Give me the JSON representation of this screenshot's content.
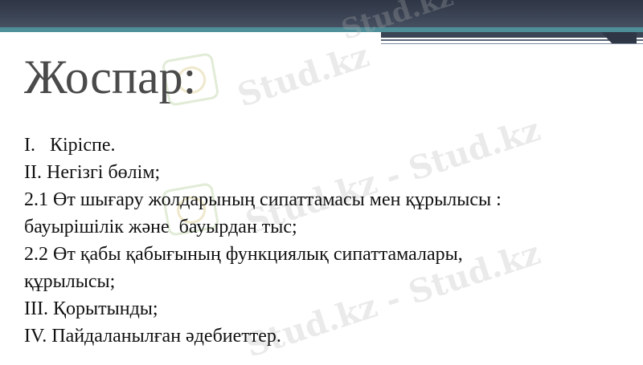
{
  "slide": {
    "title": "Жоспар:",
    "items": [
      "I.   Кіріспе.",
      "II. Негізгі бөлім;",
      "2.1 Өт шығару жолдарының сипаттамасы мен құрылысы :",
      "бауырішілік және  бауырдан тыс;",
      "2.2 Өт қабы қабығының функциялық сипаттамалары,",
      "құрылысы;",
      "III. Қорытынды;",
      "IV. Пайдаланылған әдебиеттер."
    ]
  },
  "watermark": {
    "text": "Stud.kz",
    "text_dash": "Stud.kz - Stud.kz"
  },
  "colors": {
    "header_dark": "#3b4454",
    "header_teal": "#4f8f9a",
    "title": "#4a4a4a",
    "body_text": "#111111"
  }
}
